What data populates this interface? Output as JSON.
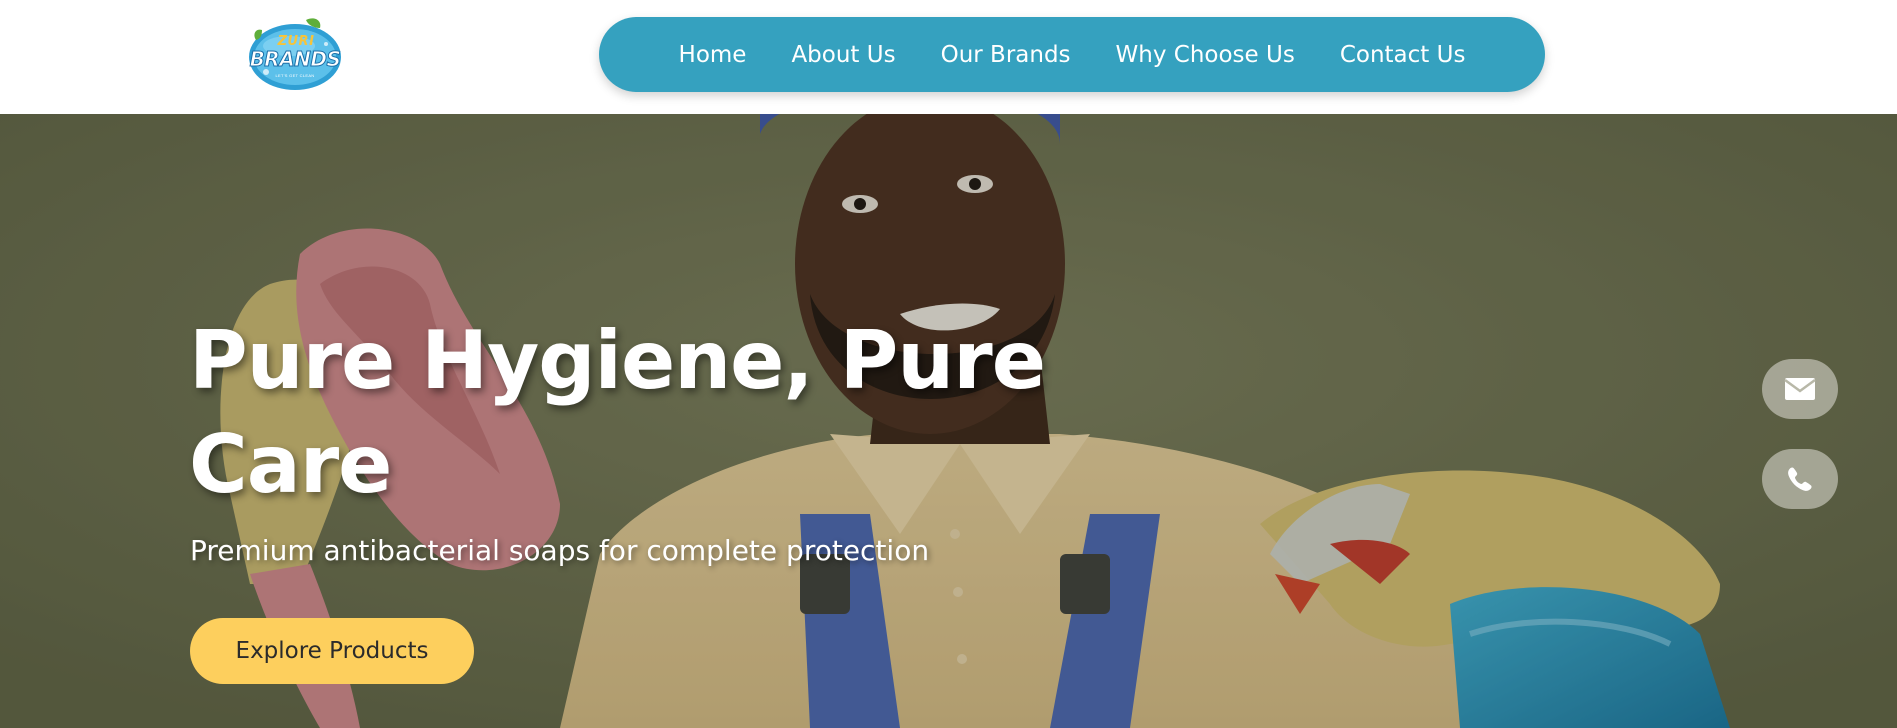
{
  "header": {
    "logo": {
      "top_text": "ZURI",
      "main_text": "BRANDS",
      "tagline": "LET'S GET CLEAN"
    },
    "nav": {
      "items": [
        {
          "label": "Home"
        },
        {
          "label": "About Us"
        },
        {
          "label": "Our Brands"
        },
        {
          "label": "Why Choose Us"
        },
        {
          "label": "Contact Us"
        }
      ]
    }
  },
  "hero": {
    "title": "Pure Hygiene, Pure Care",
    "subtitle": "Premium antibacterial soaps for complete protection",
    "cta_label": "Explore Products",
    "image_description": "photo-of-man-with-cleaning-cloth-and-spray-bottle"
  },
  "floating_actions": [
    {
      "icon": "envelope-icon"
    },
    {
      "icon": "phone-icon"
    }
  ],
  "colors": {
    "nav_background": "#35a1bf",
    "cta_background": "#fdcf5d",
    "hero_background": "#6e7252"
  }
}
